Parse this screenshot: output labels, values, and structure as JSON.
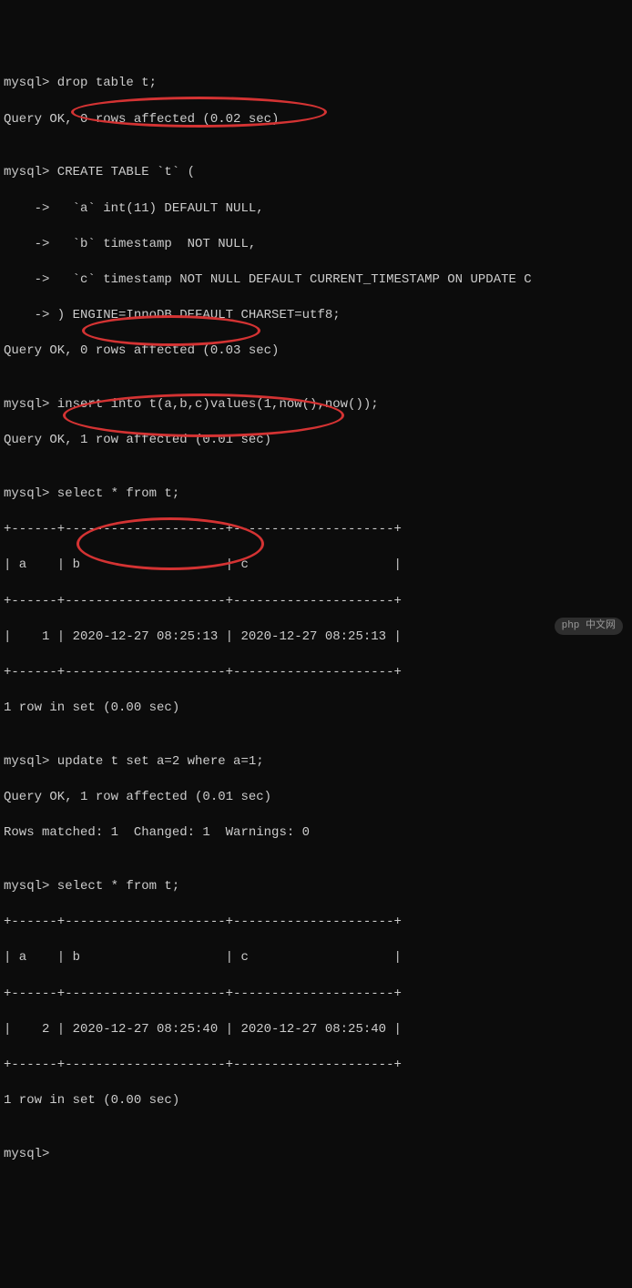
{
  "lines": {
    "l1": "mysql> drop table t;",
    "l2": "Query OK, 0 rows affected (0.02 sec)",
    "l3": "",
    "l4": "mysql> CREATE TABLE `t` (",
    "l5": "    ->   `a` int(11) DEFAULT NULL,",
    "l6": "    ->   `b` timestamp  NOT NULL,",
    "l7": "    ->   `c` timestamp NOT NULL DEFAULT CURRENT_TIMESTAMP ON UPDATE C",
    "l8": "    -> ) ENGINE=InnoDB DEFAULT CHARSET=utf8;",
    "l9": "Query OK, 0 rows affected (0.03 sec)",
    "l10": "",
    "l11": "mysql> insert into t(a,b,c)values(1,now(),now());",
    "l12": "Query OK, 1 row affected (0.01 sec)",
    "l13": "",
    "l14": "mysql> select * from t;",
    "l15": "+------+---------------------+---------------------+",
    "l16": "| a    | b                   | c                   |",
    "l17": "+------+---------------------+---------------------+",
    "l18": "|    1 | 2020-12-27 08:25:13 | 2020-12-27 08:25:13 |",
    "l19": "+------+---------------------+---------------------+",
    "l20": "1 row in set (0.00 sec)",
    "l21": "",
    "l22": "mysql> update t set a=2 where a=1;",
    "l23": "Query OK, 1 row affected (0.01 sec)",
    "l24": "Rows matched: 1  Changed: 1  Warnings: 0",
    "l25": "",
    "l26": "mysql> select * from t;",
    "l27": "+------+---------------------+---------------------+",
    "l28": "| a    | b                   | c                   |",
    "l29": "+------+---------------------+---------------------+",
    "l30": "|    2 | 2020-12-27 08:25:40 | 2020-12-27 08:25:40 |",
    "l31": "+------+---------------------+---------------------+",
    "l32": "1 row in set (0.00 sec)",
    "l33": "",
    "l34": "mysql> "
  },
  "watermark": "php 中文网"
}
